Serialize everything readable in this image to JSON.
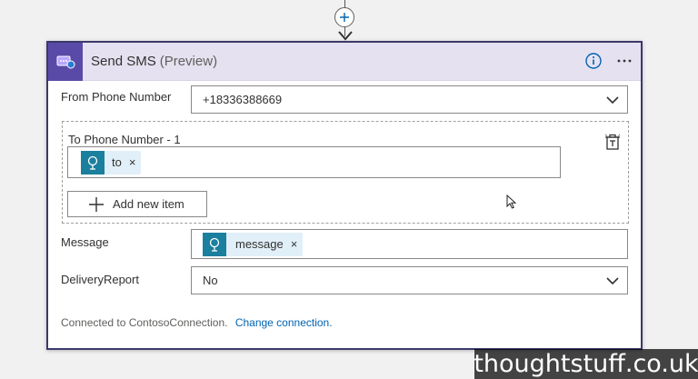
{
  "action": {
    "title": "Send SMS",
    "subtitle": "(Preview)"
  },
  "icons": {
    "header": "sms-connector-icon",
    "info": "info-icon",
    "more": "more-ellipsis-icon",
    "add_step": "plus-icon",
    "chevron": "chevron-down-icon",
    "token": "dynamic-content-icon",
    "delete_group": "delete-item-icon",
    "add_item": "plus-icon"
  },
  "fields": {
    "from": {
      "label": "From Phone Number",
      "value": "+18336388669"
    },
    "to": {
      "label": "To Phone Number - 1",
      "token": "to",
      "remove": "×",
      "add_button": "Add new item"
    },
    "message": {
      "label": "Message",
      "token": "message",
      "remove": "×"
    },
    "delivery": {
      "label": "DeliveryReport",
      "value": "No"
    }
  },
  "footer": {
    "connected_text": "Connected to ContosoConnection.",
    "change_link": "Change connection."
  },
  "watermark": "thoughtstuff.co.uk",
  "colors": {
    "header_bg": "#e6e1f1",
    "card_border": "#3b3a6b",
    "icon_bg": "#5a4aa8",
    "token_icon_bg": "#1b7f9e",
    "token_bg": "#e1eff8",
    "link": "#0063b1"
  }
}
